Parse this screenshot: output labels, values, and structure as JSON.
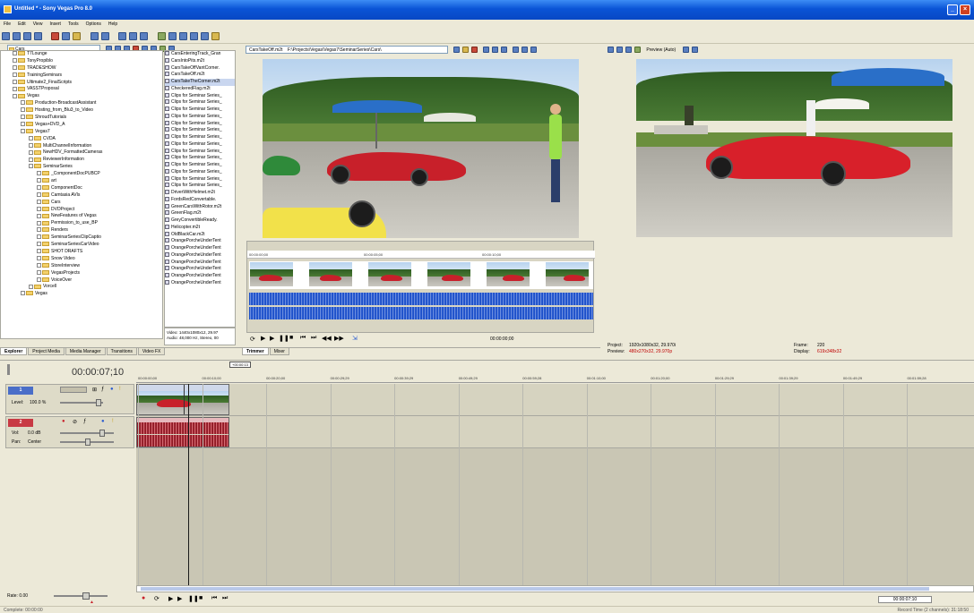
{
  "app": {
    "title": "Untitled * - Sony Vegas Pro 8.0"
  },
  "menu": [
    "File",
    "Edit",
    "View",
    "Insert",
    "Tools",
    "Options",
    "Help"
  ],
  "explorer": {
    "location": "Cars",
    "tree": [
      {
        "label": "T7Lounge",
        "indent": 1
      },
      {
        "label": "TonyPropiblo",
        "indent": 1
      },
      {
        "label": "TRADESHOW",
        "indent": 1
      },
      {
        "label": "TrainingSeminars",
        "indent": 1
      },
      {
        "label": "Ultimate2_FinalScripts",
        "indent": 1
      },
      {
        "label": "VASSTProposal",
        "indent": 1
      },
      {
        "label": "Vegas",
        "indent": 1
      },
      {
        "label": "Production-BroadcastAssistant",
        "indent": 2
      },
      {
        "label": "Hosting_from_Blu3_to_Video",
        "indent": 2
      },
      {
        "label": "ShroudTutorials",
        "indent": 2
      },
      {
        "label": "Vegas+DVD_A",
        "indent": 2
      },
      {
        "label": "Vegas7",
        "indent": 2
      },
      {
        "label": "CVDA",
        "indent": 3
      },
      {
        "label": "MultiChannelInformation",
        "indent": 3
      },
      {
        "label": "NewHDV_FormattedCameras",
        "indent": 3
      },
      {
        "label": "ReviewerInformation",
        "indent": 3
      },
      {
        "label": "SeminarSeries",
        "indent": 3
      },
      {
        "label": "_ComponentDocPUBCP",
        "indent": 4
      },
      {
        "label": "art",
        "indent": 4
      },
      {
        "label": "ComponentDoc",
        "indent": 4
      },
      {
        "label": "Camtasia AVIs",
        "indent": 4
      },
      {
        "label": "Cars",
        "indent": 4
      },
      {
        "label": "DVDProject",
        "indent": 4
      },
      {
        "label": "NewFeatures of Vegas",
        "indent": 4
      },
      {
        "label": "Permission_to_use_BP",
        "indent": 4
      },
      {
        "label": "Renders",
        "indent": 4
      },
      {
        "label": "SeminarSeriesClipCaptio",
        "indent": 4
      },
      {
        "label": "SeminarSeriesCarVideo",
        "indent": 4
      },
      {
        "label": "SHOT DRAFTS",
        "indent": 4
      },
      {
        "label": "Snow Video",
        "indent": 4
      },
      {
        "label": "StoreInterview",
        "indent": 4
      },
      {
        "label": "VegasProjects",
        "indent": 4
      },
      {
        "label": "VoiceOver",
        "indent": 4
      },
      {
        "label": "Vorcell",
        "indent": 3
      },
      {
        "label": "Vegas",
        "indent": 2
      }
    ],
    "files": [
      "CarsEnteringTrack_Gran",
      "CarsIntoPits.m2t",
      "CarsTakeOffVantCorner.",
      "CarsTakeOff.m2t",
      "CarsTakeTheCorner.m2t",
      "CheckeredFlag.m2t",
      "Clips for Seminar Series_",
      "Clips for Seminar Series_",
      "Clips for Seminar Series_",
      "Clips for Seminar Series_",
      "Clips for Seminar Series_",
      "Clips for Seminar Series_",
      "Clips for Seminar Series_",
      "Clips for Seminar Series_",
      "Clips for Seminar Series_",
      "Clips for Seminar Series_",
      "Clips for Seminar Series_",
      "Clips for Seminar Series_",
      "Clips for Seminar Series_",
      "Clips for Seminar Series_",
      "DriverWithHelmet.m2t",
      "FordsRedConvertable.",
      "GreenCarsWithRotor.m2t",
      "GreenFlag.m2t",
      "GreyConvertibleReady.",
      "Helicopter.m2t",
      "OldBlackCar.m2t",
      "OrangePorcheUnderTent",
      "OrangePorcheUnderTent",
      "OrangePorcheUnderTent",
      "OrangePorcheUnderTent",
      "OrangePorcheUnderTent",
      "OrangePorcheUnderTent",
      "OrangePorcheUnderTent"
    ],
    "media_info": [
      "Video: 1440x1080x12, 29.97",
      "Audio: 48,000 Hz, Stereo, 00"
    ],
    "tabs": [
      "Explorer",
      "Project Media",
      "Media Manager",
      "Transitions",
      "Video FX"
    ]
  },
  "trimmer": {
    "file": "CarsTakeOff.m2t",
    "path": "F:\\Projects\\Vegas\\Vegas7\\SeminarSeries\\Cars\\",
    "strip_times": [
      "00:00:00;00",
      "00:00:05;00",
      "00:00:10;00"
    ],
    "time": "00:00:00;00",
    "tabs": [
      "Trimmer",
      "Mixer"
    ]
  },
  "preview": {
    "quality": "Preview (Auto)",
    "project_label": "Project:",
    "project_value": "1920x1080x32, 29.970i",
    "preview_label": "Preview:",
    "preview_value": "480x270x32, 29.970p",
    "frame_label": "Frame:",
    "frame_value": "220",
    "display_label": "Display:",
    "display_value": "619x348x32"
  },
  "timeline": {
    "cursor": "00:00:07;10",
    "ruler_marker": "+00:00:13",
    "ruler_ticks": [
      "00:00:00;00",
      "00:00:10;00",
      "00:00:20;00",
      "00:00:29;29",
      "00:00:39;29",
      "00:00:49;29",
      "00:00:59;28",
      "00:01:10;00",
      "00:01:20;00",
      "00:01:29;29",
      "00:01:39;29",
      "00:01:49;29",
      "00:01:59;28"
    ],
    "video_track": {
      "number": "1",
      "level_label": "Level:",
      "level_value": "100.0 %"
    },
    "audio_track": {
      "number": "2",
      "vol_label": "Vol:",
      "vol_value": "0.0 dB",
      "pan_label": "Pan:",
      "pan_value": "Center"
    },
    "rate_label": "Rate: 0.00",
    "time_display": "00:00:07;10"
  },
  "status": {
    "left": "Complete: 00:00:00",
    "right": "Record Time (2 channels): 31:18:50"
  },
  "colors": {
    "titlebar": "#0a54d6",
    "chrome": "#ece9d8",
    "video_waveform": "#1d50c8",
    "audio_clip": "#8c1a24",
    "warning_text": "#c00000"
  }
}
